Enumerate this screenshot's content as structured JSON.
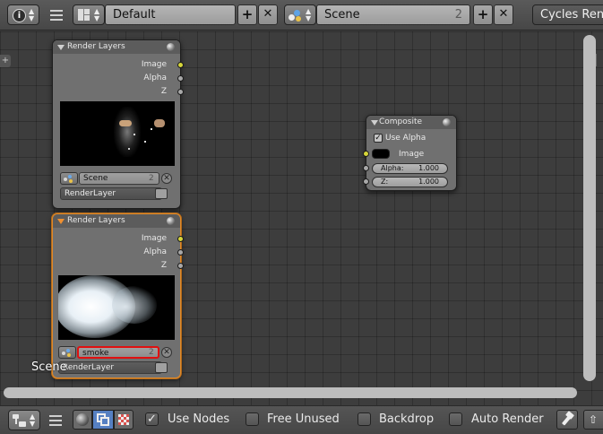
{
  "header": {
    "layout_name": "Default",
    "scene_name": "Scene",
    "scene_users": "2",
    "add_glyph": "+",
    "close_glyph": "✕",
    "render_engine": "Cycles Ren"
  },
  "nodes": {
    "render_layers_1": {
      "title": "Render Layers",
      "outputs": [
        "Image",
        "Alpha",
        "Z"
      ],
      "scene": "Scene",
      "scene_users": "2",
      "layer": "RenderLayer"
    },
    "render_layers_2": {
      "title": "Render Layers",
      "outputs": [
        "Image",
        "Alpha",
        "Z"
      ],
      "scene": "smoke",
      "scene_users": "2",
      "layer": "RenderLayer",
      "drag_label": "Scene"
    },
    "composite": {
      "title": "Composite",
      "use_alpha": "Use Alpha",
      "image_label": "Image",
      "alpha_label": "Alpha:",
      "alpha_value": "1.000",
      "z_label": "Z:",
      "z_value": "1.000"
    }
  },
  "footer": {
    "use_nodes": "Use Nodes",
    "free_unused": "Free Unused",
    "backdrop": "Backdrop",
    "auto_render": "Auto Render",
    "check_glyph": "✓"
  },
  "colors": {
    "active_outline": "#e08a2a",
    "highlight_box": "#e01010",
    "image_socket": "#d6d63a"
  }
}
